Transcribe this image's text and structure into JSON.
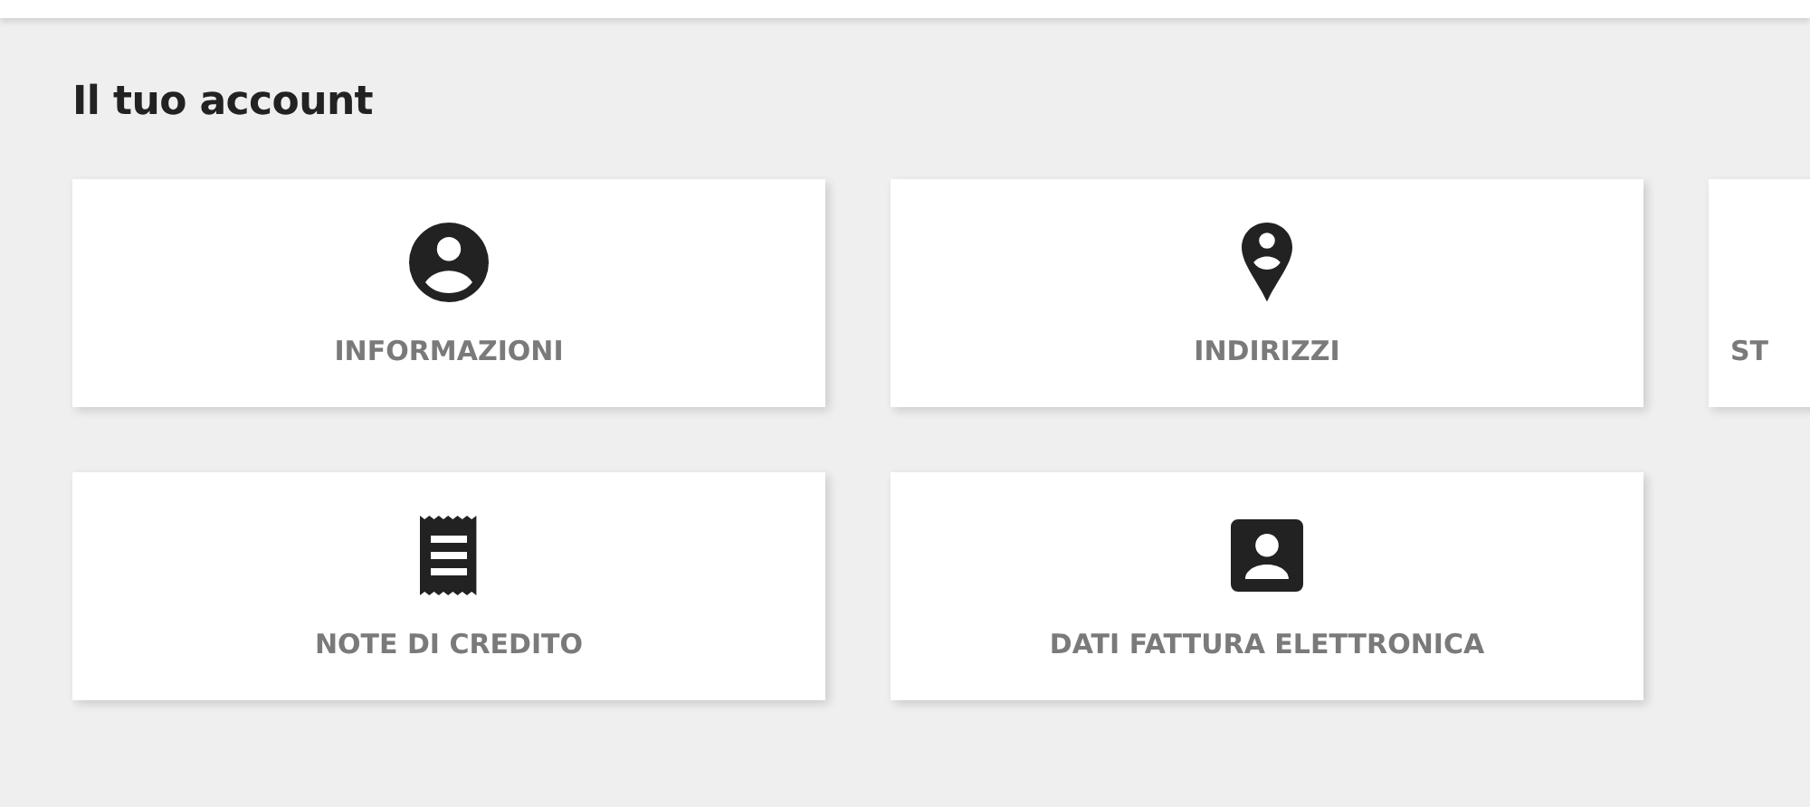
{
  "heading": "Il tuo account",
  "cards": [
    {
      "label": "INFORMAZIONI"
    },
    {
      "label": "INDIRIZZI"
    },
    {
      "label": "ST"
    },
    {
      "label": "NOTE DI CREDITO"
    },
    {
      "label": "DATI FATTURA ELETTRONICA"
    }
  ]
}
